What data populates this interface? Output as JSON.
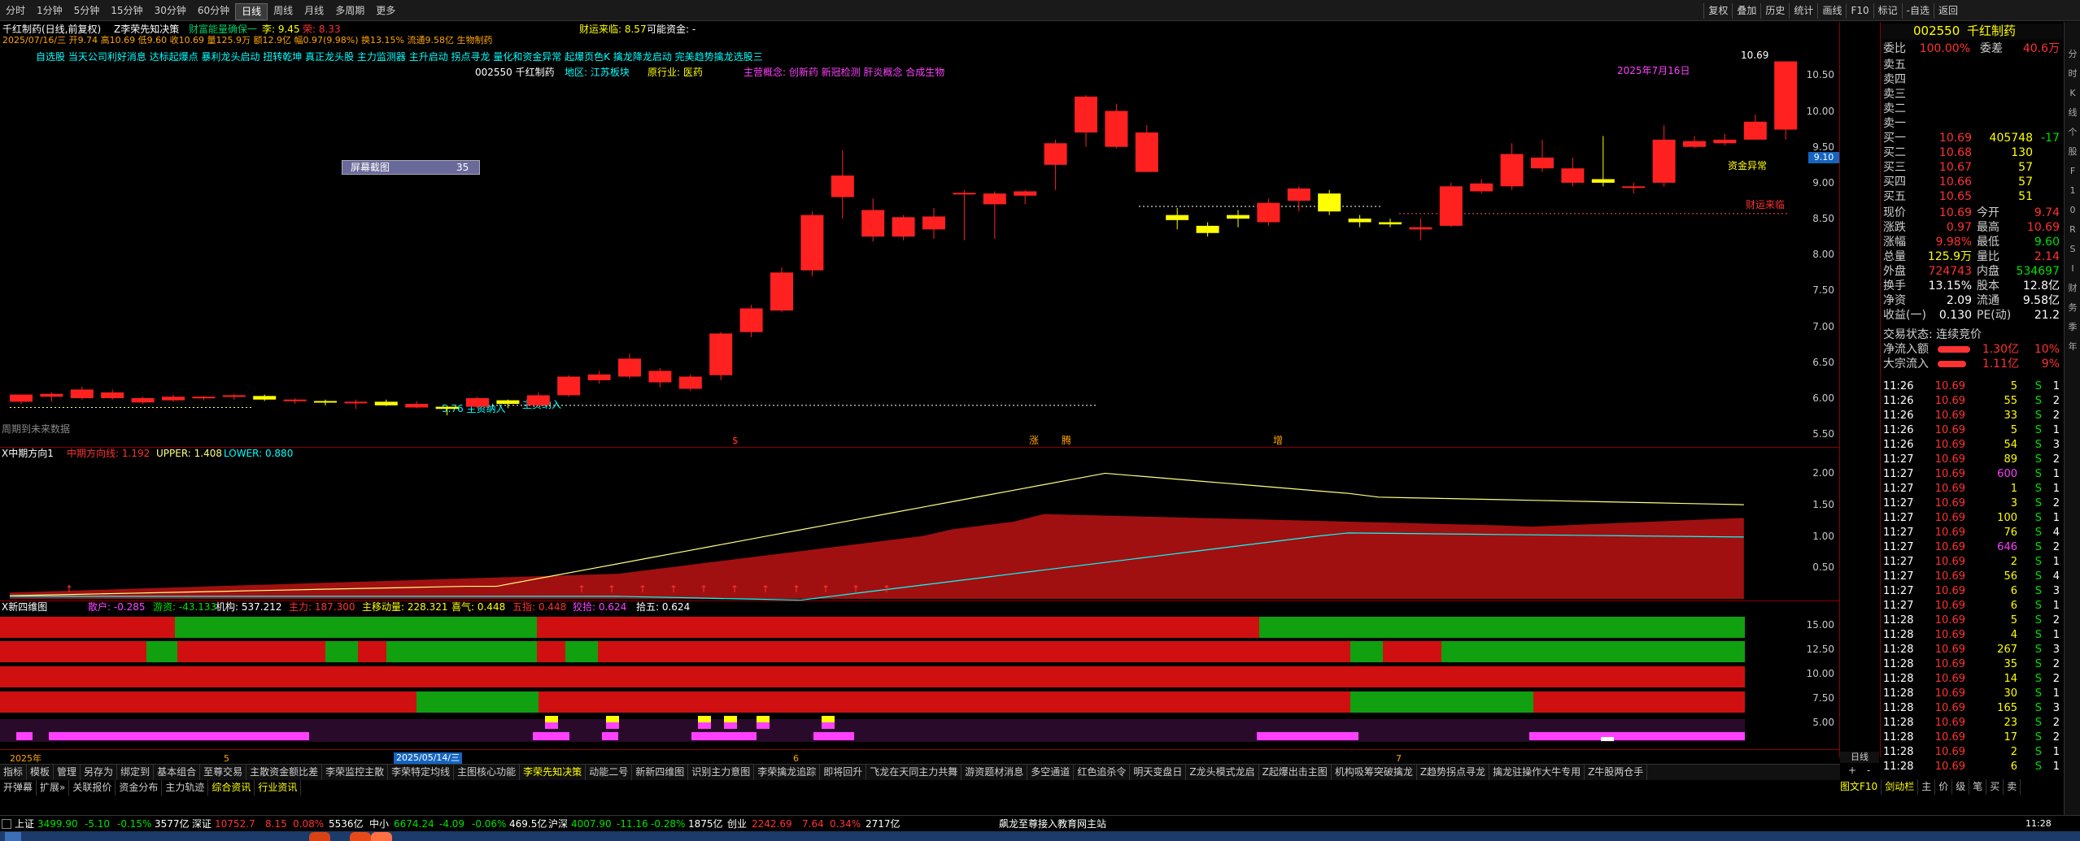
{
  "toolbar": {
    "periods": [
      "分时",
      "1分钟",
      "5分钟",
      "15分钟",
      "30分钟",
      "60分钟",
      "日线",
      "周线",
      "月线",
      "多周期",
      "更多"
    ],
    "active_period": "日线",
    "right_tools": [
      "复权",
      "叠加",
      "历史",
      "统计",
      "画线",
      "F10",
      "标记",
      "-自选",
      "返回"
    ]
  },
  "header": {
    "line1_title": "千红制药(日线,前复权)",
    "line1_ind": "Z李荣先知决策",
    "line1_ind2": "财富能量确保一",
    "line1_price_label": "李: 9.45",
    "line1_price2": "荣: 8.33",
    "finance_title": "财运来临: 8.57",
    "finance_extra": "可能资金: -",
    "line2": "2025/07/16/三 开9.74 高10.69 低9.60 收10.69 量125.9万 额12.9亿 幅0.97(9.98%) 换13.15% 流通9.58亿 生物制药",
    "line3": "自选股 当天公司利好消息 达标起爆点 暴利龙头启动 扭转乾坤 真正龙头股 主力监测器 主升启动 拐点寻龙 量化和资金异常 起爆页色K 擒龙降龙启动 完美趋势擒龙选股三",
    "stock_line": "002550  千红制药",
    "region": "地区: 江苏板块",
    "industry": "原行业: 医药",
    "concept": "主营概念: 创新药 新冠检测 肝炎概念 合成生物",
    "date_label": "2025年7月16日",
    "popup_label": "屏幕截图",
    "popup_value": "35",
    "high_label": "10.69",
    "low_label": "5.76 主资纳入",
    "low_label2": "主资纳入",
    "anomaly": "资金异常",
    "finance_line": "财运来临",
    "future_data": "周期到未来数据"
  },
  "marks": [
    {
      "t": "$"
    },
    {
      "t": "涨"
    },
    {
      "t": "腾"
    },
    {
      "t": "增"
    }
  ],
  "price_axis": [
    "10.50",
    "10.00",
    "9.50",
    "9.00",
    "8.50",
    "8.00",
    "7.50",
    "7.00",
    "6.50",
    "6.00",
    "5.50"
  ],
  "price_cursor": "9.10",
  "pane2": {
    "title": "X中期方向1",
    "mid": "中期方向线: 1.192",
    "upper": "UPPER: 1.408",
    "lower": "LOWER: 0.880",
    "axis": [
      "2.00",
      "1.50",
      "1.00",
      "0.50"
    ]
  },
  "pane3": {
    "title": "X新四维图",
    "sanhu": "散户: -0.285",
    "youzi": "游资: -43.133",
    "jigou": "机构: 537.212",
    "zhuli": "主力: 187.300",
    "zhuyidong": "主移动量: 228.321",
    "xishi": "喜气: 0.448",
    "wuxian": "五指: 0.448",
    "jiaoqian": "狡拾: 0.624",
    "kuoyou": "拾五: 0.624",
    "axis": [
      "15.00",
      "12.50",
      "10.00",
      "7.50",
      "5.00"
    ]
  },
  "date_axis": {
    "year": "2025年",
    "m5": "5",
    "cursor_date": "2025/05/14/三",
    "m6": "6",
    "m7": "7"
  },
  "right_btns": [
    "日线",
    "+",
    "-"
  ],
  "bottom_tabs1": [
    "指标",
    "模板",
    "管理",
    "另存为",
    "绑定到",
    "基本组合",
    "至尊交易",
    "主散资金额比差",
    "李荣监控主散",
    "李荣特定均线",
    "主图核心功能",
    "李荣先知决策",
    "动能二号",
    "新新四维图",
    "识别主力意图",
    "李荣擒龙追踪",
    "即将回升",
    "飞龙在天同主力共舞",
    "游资题材消息",
    "多空通道",
    "红色追杀令",
    "明天变盘日",
    "Z龙头模式龙启",
    "Z起爆出击主图",
    "机构吸筹突破擒龙",
    "Z趋势拐点寻龙",
    "擒龙驻操作大牛专用",
    "Z牛股两仓手"
  ],
  "bottom_tabs2": [
    "开弹幕",
    "扩展»",
    "关联报价",
    "资金分布",
    "主力轨迹",
    "综合资讯",
    "行业资讯"
  ],
  "bottom_right": [
    "图文F10",
    "剑动栏",
    "主",
    "价",
    "级",
    "笔",
    "买",
    "卖"
  ],
  "quote": {
    "code": "002550",
    "name": "千红制药",
    "webi": "委比",
    "webi_v": "100.00%",
    "wecha": "委差",
    "wecha_v": "40.6万",
    "sells": [
      "卖五",
      "卖四",
      "卖三",
      "卖二",
      "卖一"
    ],
    "buys": [
      {
        "l": "买一",
        "p": "10.69",
        "v": "405748",
        "c": "-17"
      },
      {
        "l": "买二",
        "p": "10.68",
        "v": "130",
        "c": ""
      },
      {
        "l": "买三",
        "p": "10.67",
        "v": "57",
        "c": ""
      },
      {
        "l": "买四",
        "p": "10.66",
        "v": "57",
        "c": ""
      },
      {
        "l": "买五",
        "p": "10.65",
        "v": "51",
        "c": ""
      }
    ],
    "stats": [
      {
        "a": "现价",
        "av": "10.69",
        "b": "今开",
        "bv": "9.74"
      },
      {
        "a": "涨跌",
        "av": "0.97",
        "b": "最高",
        "bv": "10.69"
      },
      {
        "a": "涨幅",
        "av": "9.98%",
        "b": "最低",
        "bv": "9.60"
      },
      {
        "a": "总量",
        "av": "125.9万",
        "b": "量比",
        "bv": "2.14"
      },
      {
        "a": "外盘",
        "av": "724743",
        "b": "内盘",
        "bv": "534697"
      },
      {
        "a": "换手",
        "av": "13.15%",
        "b": "股本",
        "bv": "12.8亿"
      },
      {
        "a": "净资",
        "av": "2.09",
        "b": "流通",
        "bv": "9.58亿"
      },
      {
        "a": "收益(一)",
        "av": "0.130",
        "b": "PE(动)",
        "bv": "21.2"
      }
    ],
    "state": "交易状态: 连续竞价",
    "netin1": "净流入额",
    "netin1_v": "1.30亿",
    "netin1_p": "10%",
    "netin2": "大宗流入",
    "netin2_v": "1.11亿",
    "netin2_p": "9%",
    "ticks": [
      {
        "t": "11:26",
        "p": "10.69",
        "v": "5",
        "s": "S",
        "n": "1"
      },
      {
        "t": "11:26",
        "p": "10.69",
        "v": "55",
        "s": "S",
        "n": "2"
      },
      {
        "t": "11:26",
        "p": "10.69",
        "v": "33",
        "s": "S",
        "n": "2"
      },
      {
        "t": "11:26",
        "p": "10.69",
        "v": "5",
        "s": "S",
        "n": "1"
      },
      {
        "t": "11:26",
        "p": "10.69",
        "v": "54",
        "s": "S",
        "n": "3"
      },
      {
        "t": "11:27",
        "p": "10.69",
        "v": "89",
        "s": "S",
        "n": "2"
      },
      {
        "t": "11:27",
        "p": "10.69",
        "v": "600",
        "s": "S",
        "n": "1"
      },
      {
        "t": "11:27",
        "p": "10.69",
        "v": "1",
        "s": "S",
        "n": "1"
      },
      {
        "t": "11:27",
        "p": "10.69",
        "v": "3",
        "s": "S",
        "n": "2"
      },
      {
        "t": "11:27",
        "p": "10.69",
        "v": "100",
        "s": "S",
        "n": "1"
      },
      {
        "t": "11:27",
        "p": "10.69",
        "v": "76",
        "s": "S",
        "n": "4"
      },
      {
        "t": "11:27",
        "p": "10.69",
        "v": "646",
        "s": "S",
        "n": "2"
      },
      {
        "t": "11:27",
        "p": "10.69",
        "v": "2",
        "s": "S",
        "n": "1"
      },
      {
        "t": "11:27",
        "p": "10.69",
        "v": "56",
        "s": "S",
        "n": "4"
      },
      {
        "t": "11:27",
        "p": "10.69",
        "v": "6",
        "s": "S",
        "n": "3"
      },
      {
        "t": "11:27",
        "p": "10.69",
        "v": "6",
        "s": "S",
        "n": "1"
      },
      {
        "t": "11:28",
        "p": "10.69",
        "v": "5",
        "s": "S",
        "n": "2"
      },
      {
        "t": "11:28",
        "p": "10.69",
        "v": "4",
        "s": "S",
        "n": "1"
      },
      {
        "t": "11:28",
        "p": "10.69",
        "v": "267",
        "s": "S",
        "n": "3"
      },
      {
        "t": "11:28",
        "p": "10.69",
        "v": "35",
        "s": "S",
        "n": "2"
      },
      {
        "t": "11:28",
        "p": "10.69",
        "v": "14",
        "s": "S",
        "n": "2"
      },
      {
        "t": "11:28",
        "p": "10.69",
        "v": "30",
        "s": "S",
        "n": "1"
      },
      {
        "t": "11:28",
        "p": "10.69",
        "v": "165",
        "s": "S",
        "n": "3"
      },
      {
        "t": "11:28",
        "p": "10.69",
        "v": "23",
        "s": "S",
        "n": "2"
      },
      {
        "t": "11:28",
        "p": "10.69",
        "v": "17",
        "s": "S",
        "n": "2"
      },
      {
        "t": "11:28",
        "p": "10.69",
        "v": "2",
        "s": "S",
        "n": "1"
      },
      {
        "t": "11:28",
        "p": "10.69",
        "v": "6",
        "s": "S",
        "n": "1"
      }
    ]
  },
  "sidebar": [
    "分",
    "时",
    "K",
    "线",
    "个",
    "股",
    "F",
    "1",
    "0",
    "R",
    "S",
    "I",
    "财",
    "务",
    "季",
    "年"
  ],
  "status": {
    "sh": "上证",
    "sh_v": "3499.90",
    "sh_c": "-5.10",
    "sh_p": "-0.15%",
    "sh_a": "3577亿",
    "sz": "深证",
    "sz_v": "10752.7",
    "sz_c": "8.15",
    "sz_p": "0.08%",
    "sz_a": "5536亿",
    "zx": "中小",
    "zx_v": "6674.24",
    "zx_c": "-4.09",
    "zx_p": "-0.06%",
    "zx_a": "469.5亿",
    "hs": "沪深",
    "hs_v": "4007.90",
    "hs_c": "-11.16",
    "hs_p": "-0.28%",
    "hs_a": "1875亿",
    "cy": "创业",
    "cy_v": "2242.69",
    "cy_c": "7.64",
    "cy_p": "0.34%",
    "cy_a": "2717亿",
    "news": "飙龙至尊接入教育网主站",
    "clock": "11:28"
  },
  "candles": [
    {
      "o": 6.05,
      "h": 6.05,
      "l": 5.92,
      "c": 5.95
    },
    {
      "o": 6.02,
      "h": 6.08,
      "l": 5.95,
      "c": 6.06
    },
    {
      "o": 6.12,
      "h": 6.16,
      "l": 5.98,
      "c": 6.0
    },
    {
      "o": 6.08,
      "h": 6.12,
      "l": 5.98,
      "c": 6.0
    },
    {
      "o": 6.0,
      "h": 6.02,
      "l": 5.92,
      "c": 5.94
    },
    {
      "o": 6.02,
      "h": 6.05,
      "l": 5.95,
      "c": 5.97
    },
    {
      "o": 6.0,
      "h": 6.03,
      "l": 5.97,
      "c": 6.02
    },
    {
      "o": 6.02,
      "h": 6.06,
      "l": 5.98,
      "c": 6.04
    },
    {
      "o": 6.03,
      "h": 6.05,
      "l": 5.96,
      "c": 5.98
    },
    {
      "o": 5.97,
      "h": 6.0,
      "l": 5.92,
      "c": 5.98
    },
    {
      "o": 5.95,
      "h": 5.98,
      "l": 5.9,
      "c": 5.96
    },
    {
      "o": 5.93,
      "h": 5.98,
      "l": 5.85,
      "c": 5.95
    },
    {
      "o": 5.95,
      "h": 5.98,
      "l": 5.89,
      "c": 5.9
    },
    {
      "o": 5.92,
      "h": 5.96,
      "l": 5.86,
      "c": 5.87
    },
    {
      "o": 5.88,
      "h": 5.9,
      "l": 5.76,
      "c": 5.85
    },
    {
      "o": 6.0,
      "h": 6.02,
      "l": 5.85,
      "c": 5.88
    },
    {
      "o": 5.92,
      "h": 5.98,
      "l": 5.86,
      "c": 5.97
    },
    {
      "o": 6.04,
      "h": 6.08,
      "l": 5.86,
      "c": 5.9
    },
    {
      "o": 6.3,
      "h": 6.32,
      "l": 6.02,
      "c": 6.04
    },
    {
      "o": 6.33,
      "h": 6.38,
      "l": 6.2,
      "c": 6.25
    },
    {
      "o": 6.55,
      "h": 6.62,
      "l": 6.27,
      "c": 6.3
    },
    {
      "o": 6.38,
      "h": 6.42,
      "l": 6.15,
      "c": 6.22
    },
    {
      "o": 6.3,
      "h": 6.33,
      "l": 6.1,
      "c": 6.13
    },
    {
      "o": 6.9,
      "h": 6.92,
      "l": 6.25,
      "c": 6.32
    },
    {
      "o": 7.25,
      "h": 7.3,
      "l": 6.85,
      "c": 6.92
    },
    {
      "o": 7.75,
      "h": 7.82,
      "l": 7.2,
      "c": 7.22
    },
    {
      "o": 8.55,
      "h": 8.6,
      "l": 7.7,
      "c": 7.78
    },
    {
      "o": 9.1,
      "h": 9.45,
      "l": 8.5,
      "c": 8.8
    },
    {
      "o": 8.62,
      "h": 8.78,
      "l": 8.18,
      "c": 8.25
    },
    {
      "o": 8.25,
      "h": 8.55,
      "l": 8.2,
      "c": 8.52
    },
    {
      "o": 8.53,
      "h": 8.65,
      "l": 8.22,
      "c": 8.35
    },
    {
      "o": 8.85,
      "h": 8.9,
      "l": 8.2,
      "c": 8.86
    },
    {
      "o": 8.7,
      "h": 8.88,
      "l": 8.22,
      "c": 8.85
    },
    {
      "o": 8.88,
      "h": 8.9,
      "l": 8.7,
      "c": 8.82
    },
    {
      "o": 9.55,
      "h": 9.6,
      "l": 8.9,
      "c": 9.25
    },
    {
      "o": 10.2,
      "h": 10.22,
      "l": 9.5,
      "c": 9.7
    },
    {
      "o": 10.0,
      "h": 10.1,
      "l": 9.48,
      "c": 9.5
    },
    {
      "o": 9.7,
      "h": 9.8,
      "l": 9.15,
      "c": 9.15
    },
    {
      "o": 8.55,
      "h": 8.65,
      "l": 8.35,
      "c": 8.48
    },
    {
      "o": 8.4,
      "h": 8.45,
      "l": 8.25,
      "c": 8.3
    },
    {
      "o": 8.55,
      "h": 8.62,
      "l": 8.38,
      "c": 8.5
    },
    {
      "o": 8.72,
      "h": 8.78,
      "l": 8.4,
      "c": 8.45
    },
    {
      "o": 8.92,
      "h": 8.95,
      "l": 8.6,
      "c": 8.75
    },
    {
      "o": 8.85,
      "h": 8.9,
      "l": 8.55,
      "c": 8.6
    },
    {
      "o": 8.5,
      "h": 8.55,
      "l": 8.38,
      "c": 8.45
    },
    {
      "o": 8.45,
      "h": 8.5,
      "l": 8.38,
      "c": 8.42
    },
    {
      "o": 8.35,
      "h": 8.5,
      "l": 8.2,
      "c": 8.38
    },
    {
      "o": 8.95,
      "h": 9.0,
      "l": 8.38,
      "c": 8.4
    },
    {
      "o": 8.99,
      "h": 9.05,
      "l": 8.85,
      "c": 8.88
    },
    {
      "o": 9.4,
      "h": 9.55,
      "l": 8.9,
      "c": 8.95
    },
    {
      "o": 9.35,
      "h": 9.6,
      "l": 9.15,
      "c": 9.2
    },
    {
      "o": 9.2,
      "h": 9.35,
      "l": 8.95,
      "c": 9.0
    },
    {
      "o": 9.05,
      "h": 9.65,
      "l": 8.95,
      "c": 9.0
    },
    {
      "o": 8.95,
      "h": 9.0,
      "l": 8.85,
      "c": 8.95
    },
    {
      "o": 9.6,
      "h": 9.8,
      "l": 8.95,
      "c": 9.0
    },
    {
      "o": 9.58,
      "h": 9.65,
      "l": 9.48,
      "c": 9.5
    },
    {
      "o": 9.6,
      "h": 9.68,
      "l": 9.52,
      "c": 9.55
    },
    {
      "o": 9.85,
      "h": 9.95,
      "l": 9.6,
      "c": 9.6
    },
    {
      "o": 10.69,
      "h": 10.69,
      "l": 9.6,
      "c": 9.74
    }
  ]
}
